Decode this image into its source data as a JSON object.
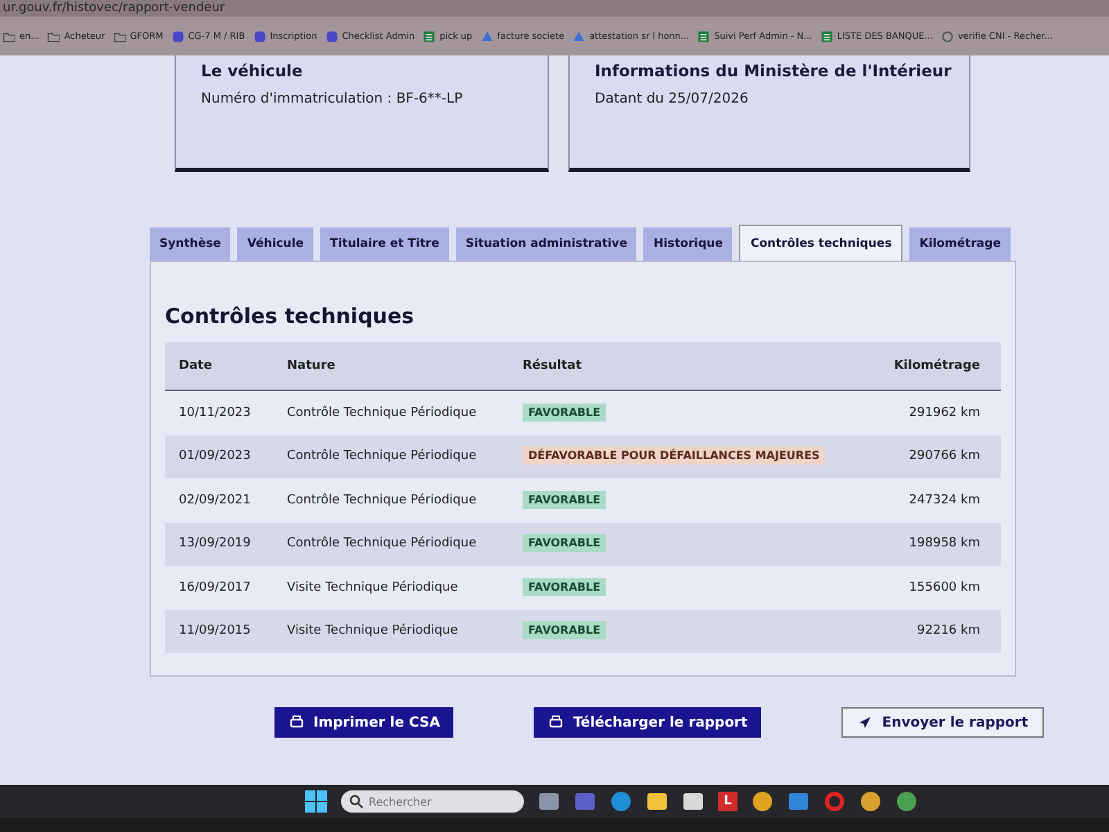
{
  "browser": {
    "address": "ur.gouv.fr/histovec/rapport-vendeur",
    "bookmarks": [
      {
        "label": "en...",
        "kind": "folder"
      },
      {
        "label": "Acheteur",
        "kind": "folder"
      },
      {
        "label": "GFORM",
        "kind": "folder"
      },
      {
        "label": "CG-7 M / RIB",
        "kind": "site"
      },
      {
        "label": "Inscription",
        "kind": "site"
      },
      {
        "label": "Checklist Admin",
        "kind": "site"
      },
      {
        "label": "pick up",
        "kind": "sheet"
      },
      {
        "label": "facture societe",
        "kind": "drive"
      },
      {
        "label": "attestation sr l honn...",
        "kind": "drive"
      },
      {
        "label": "Suivi Perf Admin - N...",
        "kind": "sheet"
      },
      {
        "label": "LISTE DES BANQUE...",
        "kind": "sheet"
      },
      {
        "label": "verifie CNI - Recher...",
        "kind": "google"
      }
    ]
  },
  "cards": [
    {
      "title": "Le véhicule",
      "text": "Numéro d'immatriculation : BF-6**-LP"
    },
    {
      "title": "Informations du Ministère de l'Intérieur",
      "text": "Datant du 25/07/2026"
    }
  ],
  "tabs": [
    {
      "label": "Synthèse",
      "selected": false
    },
    {
      "label": "Véhicule",
      "selected": false
    },
    {
      "label": "Titulaire et Titre",
      "selected": false
    },
    {
      "label": "Situation administrative",
      "selected": false
    },
    {
      "label": "Historique",
      "selected": false
    },
    {
      "label": "Contrôles techniques",
      "selected": true
    },
    {
      "label": "Kilométrage",
      "selected": false
    }
  ],
  "section_title": "Contrôles techniques",
  "table": {
    "columns": [
      "Date",
      "Nature",
      "Résultat",
      "Kilométrage"
    ],
    "rows": [
      {
        "date": "10/11/2023",
        "nature": "Contrôle Technique Périodique",
        "result": "FAVORABLE",
        "kind": "favorable",
        "mileage": "291962 km"
      },
      {
        "date": "01/09/2023",
        "nature": "Contrôle Technique Périodique",
        "result": "DÉFAVORABLE POUR DÉFAILLANCES MAJEURES",
        "kind": "unfavorable",
        "mileage": "290766 km"
      },
      {
        "date": "02/09/2021",
        "nature": "Contrôle Technique Périodique",
        "result": "FAVORABLE",
        "kind": "favorable",
        "mileage": "247324 km"
      },
      {
        "date": "13/09/2019",
        "nature": "Contrôle Technique Périodique",
        "result": "FAVORABLE",
        "kind": "favorable",
        "mileage": "198958 km"
      },
      {
        "date": "16/09/2017",
        "nature": "Visite Technique Périodique",
        "result": "FAVORABLE",
        "kind": "favorable",
        "mileage": "155600 km"
      },
      {
        "date": "11/09/2015",
        "nature": "Visite Technique Périodique",
        "result": "FAVORABLE",
        "kind": "favorable",
        "mileage": "92216 km"
      }
    ]
  },
  "actions": [
    {
      "label": "Imprimer le CSA",
      "kind": "primary"
    },
    {
      "label": "Télécharger le rapport",
      "kind": "primary"
    },
    {
      "label": "Envoyer le rapport",
      "kind": "secondary"
    }
  ],
  "taskbar": {
    "search": {
      "placeholder": "Rechercher"
    },
    "apps": [
      {
        "kind": "square",
        "color": "#8a94a8"
      },
      {
        "kind": "square",
        "color": "#5b5fc7"
      },
      {
        "kind": "round",
        "color": "#1e8fd6"
      },
      {
        "kind": "square",
        "color": "#f2c23c"
      },
      {
        "kind": "square",
        "color": "#d8d8d8"
      },
      {
        "kind": "letter",
        "color": "#d22b2b",
        "text": "L"
      },
      {
        "kind": "round",
        "color": "#e0a020"
      },
      {
        "kind": "square",
        "color": "#2f86d8"
      },
      {
        "kind": "ring",
        "color": "#e02424"
      },
      {
        "kind": "round",
        "color": "#d9a030"
      },
      {
        "kind": "round",
        "color": "#4aa050"
      }
    ]
  }
}
